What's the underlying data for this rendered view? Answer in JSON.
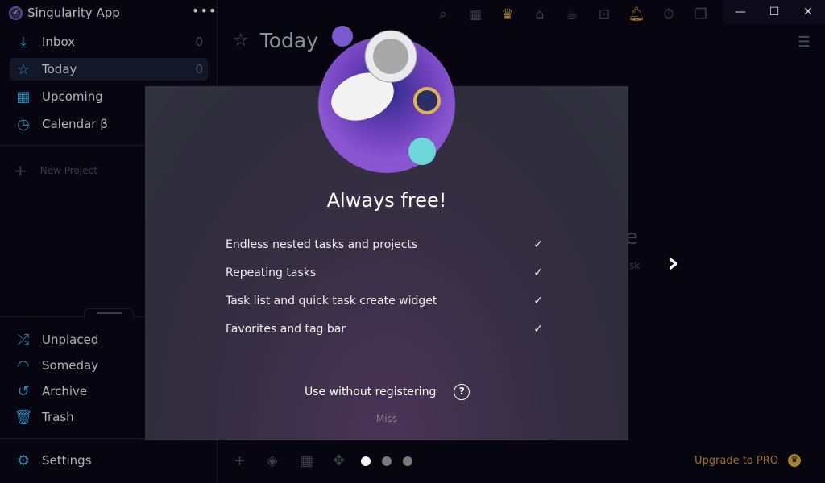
{
  "app": {
    "title": "Singularity App",
    "more_icon": "more-horizontal-icon"
  },
  "sidebar": {
    "items": [
      {
        "label": "Inbox",
        "count": "0",
        "icon": "inbox-icon"
      },
      {
        "label": "Today",
        "count": "0",
        "icon": "star-icon",
        "active": true
      },
      {
        "label": "Upcoming",
        "icon": "calendar-grid-icon"
      },
      {
        "label": "Calendar β",
        "icon": "calendar-clock-icon"
      }
    ],
    "new_project": "New Project",
    "bottom_items": [
      {
        "label": "Unplaced",
        "icon": "shuffle-icon"
      },
      {
        "label": "Someday",
        "icon": "rainbow-icon"
      },
      {
        "label": "Archive",
        "icon": "history-icon"
      },
      {
        "label": "Trash",
        "icon": "trash-icon"
      }
    ],
    "settings": "Settings"
  },
  "toolbar": {
    "icons": [
      "search-icon",
      "calendar-icon",
      "medal-icon",
      "tag-icon",
      "coffee-icon",
      "focus-icon",
      "bell-icon",
      "stopwatch-icon",
      "copy-icon"
    ]
  },
  "main": {
    "title": "Today",
    "bg_fragment_1": "e",
    "bg_fragment_2": "sk"
  },
  "modal": {
    "heading": "Always free!",
    "features": [
      "Endless nested tasks and projects",
      "Repeating tasks",
      "Task list and quick task create widget",
      "Favorites and tag bar"
    ],
    "use_without_registering": "Use without registering",
    "help": "?",
    "miss": "Miss",
    "pager": {
      "current": 1,
      "total": 3
    }
  },
  "footer": {
    "upgrade": "Upgrade to PRO"
  },
  "colors": {
    "accent": "#2a86b4",
    "gold": "#a87f2a",
    "background": "#07050f"
  }
}
